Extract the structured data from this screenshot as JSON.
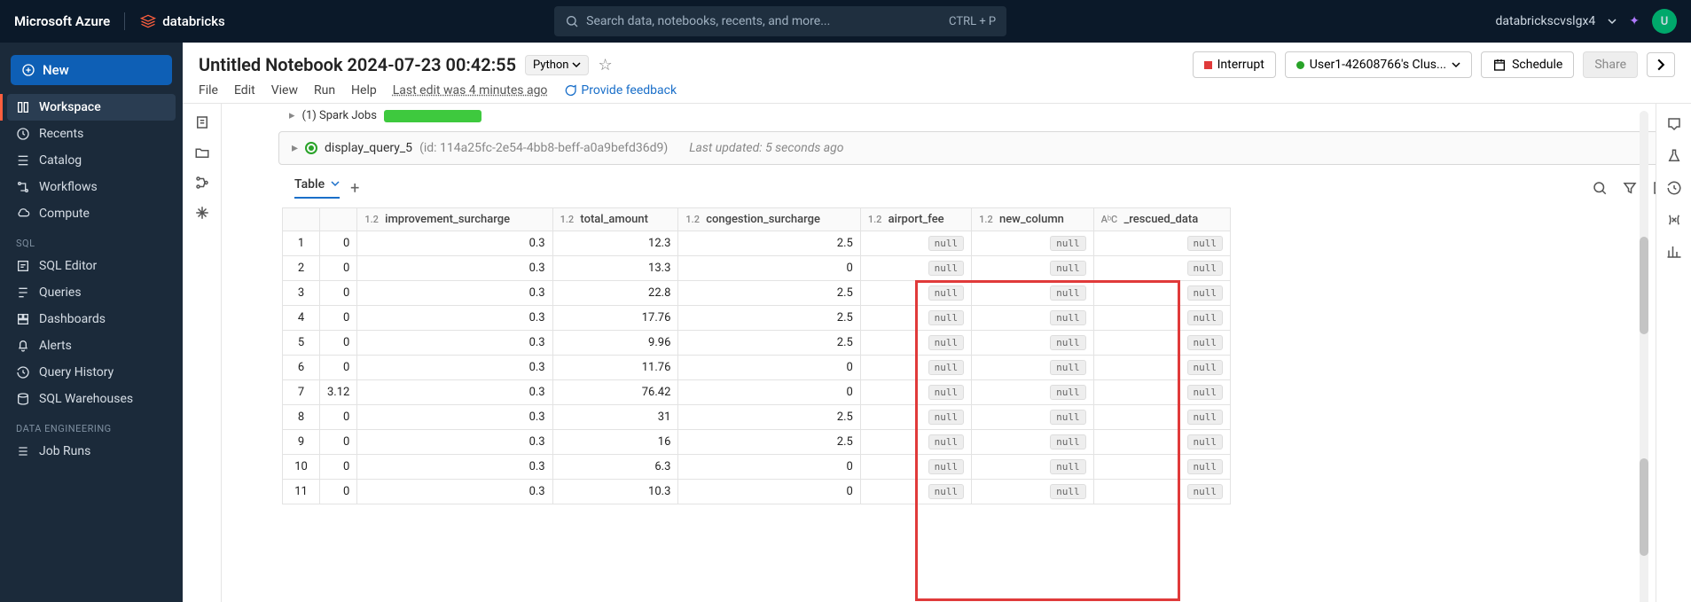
{
  "topbar": {
    "azure": "Microsoft Azure",
    "brand": "databricks",
    "search_ph": "Search data, notebooks, recents, and more...",
    "shortcut": "CTRL + P",
    "user": "databrickscvslgx4",
    "avatar": "U"
  },
  "sidebar": {
    "new": "New",
    "items": [
      "Workspace",
      "Recents",
      "Catalog",
      "Workflows",
      "Compute"
    ],
    "sql_label": "SQL",
    "sql": [
      "SQL Editor",
      "Queries",
      "Dashboards",
      "Alerts",
      "Query History",
      "SQL Warehouses"
    ],
    "de_label": "Data Engineering",
    "de": [
      "Job Runs"
    ]
  },
  "header": {
    "title": "Untitled Notebook 2024-07-23 00:42:55",
    "lang": "Python",
    "menu": [
      "File",
      "Edit",
      "View",
      "Run",
      "Help"
    ],
    "last_edit": "Last edit was 4 minutes ago",
    "feedback": "Provide feedback",
    "interrupt": "Interrupt",
    "cluster": "User1-42608766's Clus...",
    "schedule": "Schedule",
    "share": "Share"
  },
  "cell": {
    "jobs": "(1) Spark Jobs",
    "query": "display_query_5",
    "qid": "(id: 114a25fc-2e54-4bb8-beff-a0a9befd36d9)",
    "updated": "Last updated: 5 seconds ago"
  },
  "table": {
    "label": "Table",
    "columns": [
      {
        "type": "1.2",
        "name": "improvement_surcharge"
      },
      {
        "type": "1.2",
        "name": "total_amount"
      },
      {
        "type": "1.2",
        "name": "congestion_surcharge"
      },
      {
        "type": "1.2",
        "name": "airport_fee"
      },
      {
        "type": "1.2",
        "name": "new_column"
      },
      {
        "type": "AᵇC",
        "name": "_rescued_data"
      }
    ],
    "rows": [
      {
        "i": 1,
        "c0": "0",
        "imp": "0.3",
        "tot": "12.3",
        "cong": "2.5",
        "air": "null",
        "new": "null",
        "res": "null"
      },
      {
        "i": 2,
        "c0": "0",
        "imp": "0.3",
        "tot": "13.3",
        "cong": "0",
        "air": "null",
        "new": "null",
        "res": "null"
      },
      {
        "i": 3,
        "c0": "0",
        "imp": "0.3",
        "tot": "22.8",
        "cong": "2.5",
        "air": "null",
        "new": "null",
        "res": "null"
      },
      {
        "i": 4,
        "c0": "0",
        "imp": "0.3",
        "tot": "17.76",
        "cong": "2.5",
        "air": "null",
        "new": "null",
        "res": "null"
      },
      {
        "i": 5,
        "c0": "0",
        "imp": "0.3",
        "tot": "9.96",
        "cong": "2.5",
        "air": "null",
        "new": "null",
        "res": "null"
      },
      {
        "i": 6,
        "c0": "0",
        "imp": "0.3",
        "tot": "11.76",
        "cong": "0",
        "air": "null",
        "new": "null",
        "res": "null"
      },
      {
        "i": 7,
        "c0": "3.12",
        "imp": "0.3",
        "tot": "76.42",
        "cong": "0",
        "air": "null",
        "new": "null",
        "res": "null"
      },
      {
        "i": 8,
        "c0": "0",
        "imp": "0.3",
        "tot": "31",
        "cong": "2.5",
        "air": "null",
        "new": "null",
        "res": "null"
      },
      {
        "i": 9,
        "c0": "0",
        "imp": "0.3",
        "tot": "16",
        "cong": "2.5",
        "air": "null",
        "new": "null",
        "res": "null"
      },
      {
        "i": 10,
        "c0": "0",
        "imp": "0.3",
        "tot": "6.3",
        "cong": "0",
        "air": "null",
        "new": "null",
        "res": "null"
      },
      {
        "i": 11,
        "c0": "0",
        "imp": "0.3",
        "tot": "10.3",
        "cong": "0",
        "air": "null",
        "new": "null",
        "res": "null"
      }
    ]
  }
}
